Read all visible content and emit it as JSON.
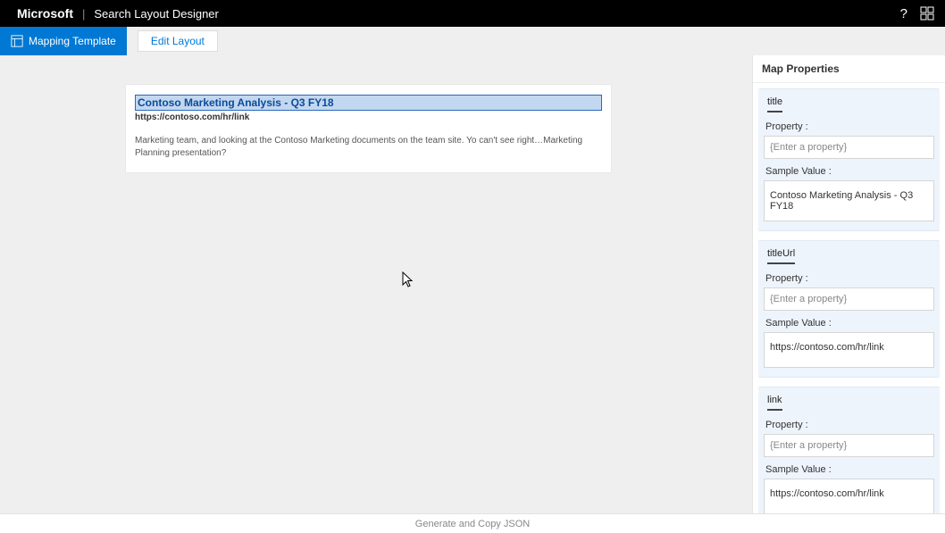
{
  "header": {
    "brand": "Microsoft",
    "appName": "Search Layout Designer"
  },
  "toolbar": {
    "mappingTemplateLabel": "Mapping Template",
    "editLayoutLabel": "Edit Layout"
  },
  "preview": {
    "title": "Contoso Marketing Analysis - Q3 FY18",
    "url": "https://contoso.com/hr/link",
    "body": "Marketing team, and looking at the Contoso Marketing documents on the team site. Yo can't see right…Marketing Planning presentation?"
  },
  "mapPanel": {
    "heading": "Map Properties",
    "propertyLabel": "Property :",
    "sampleValueLabel": "Sample Value :",
    "propertyPlaceholder": "{Enter a property}",
    "items": [
      {
        "name": "title",
        "property": "",
        "sampleValue": "Contoso Marketing Analysis - Q3 FY18"
      },
      {
        "name": "titleUrl",
        "property": "",
        "sampleValue": "https://contoso.com/hr/link"
      },
      {
        "name": "link",
        "property": "",
        "sampleValue": "https://contoso.com/hr/link"
      }
    ]
  },
  "footer": {
    "generateLabel": "Generate and Copy JSON"
  }
}
